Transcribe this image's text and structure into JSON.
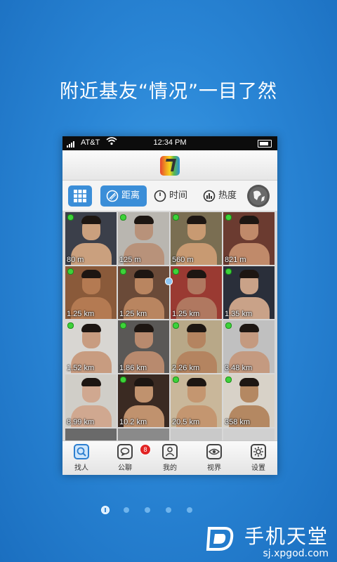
{
  "headline": "附近基友“情况”一目了然",
  "status": {
    "carrier": "AT&T",
    "time": "12:34 PM"
  },
  "toolbar": {
    "grid_icon": "grid-icon",
    "tabs": [
      {
        "label": "距离",
        "icon": "compass-icon",
        "active": true
      },
      {
        "label": "时间",
        "icon": "clock-icon",
        "active": false
      },
      {
        "label": "热度",
        "icon": "bar-chart-icon",
        "active": false
      }
    ],
    "globe_icon": "globe-icon"
  },
  "tiles": [
    {
      "distance": "80 m",
      "online": true
    },
    {
      "distance": "125 m",
      "online": true
    },
    {
      "distance": "560 m",
      "online": true
    },
    {
      "distance": "821 m",
      "online": true
    },
    {
      "distance": "1.25 km",
      "online": true
    },
    {
      "distance": "1.25 km",
      "online": true
    },
    {
      "distance": "1.25 km",
      "online": true
    },
    {
      "distance": "1.35 km",
      "online": true
    },
    {
      "distance": "1.52 km",
      "online": true
    },
    {
      "distance": "1.86 km",
      "online": true
    },
    {
      "distance": "2.26 km",
      "online": true
    },
    {
      "distance": "3.48 km",
      "online": true
    },
    {
      "distance": "8.99 km",
      "online": false
    },
    {
      "distance": "10.2 km",
      "online": true
    },
    {
      "distance": "20.5 km",
      "online": true
    },
    {
      "distance": "358 km",
      "online": true
    }
  ],
  "tabbar": [
    {
      "label": "找人",
      "icon": "search-icon",
      "active": true
    },
    {
      "label": "公聊",
      "icon": "chat-icon",
      "active": false,
      "badge": "8"
    },
    {
      "label": "我的",
      "icon": "person-icon",
      "active": false
    },
    {
      "label": "视界",
      "icon": "eye-icon",
      "active": false
    },
    {
      "label": "设置",
      "icon": "gear-icon",
      "active": false
    }
  ],
  "pager": {
    "count": 5,
    "active": 0
  },
  "watermark": {
    "title": "手机天堂",
    "url": "sj.xpgod.com"
  }
}
